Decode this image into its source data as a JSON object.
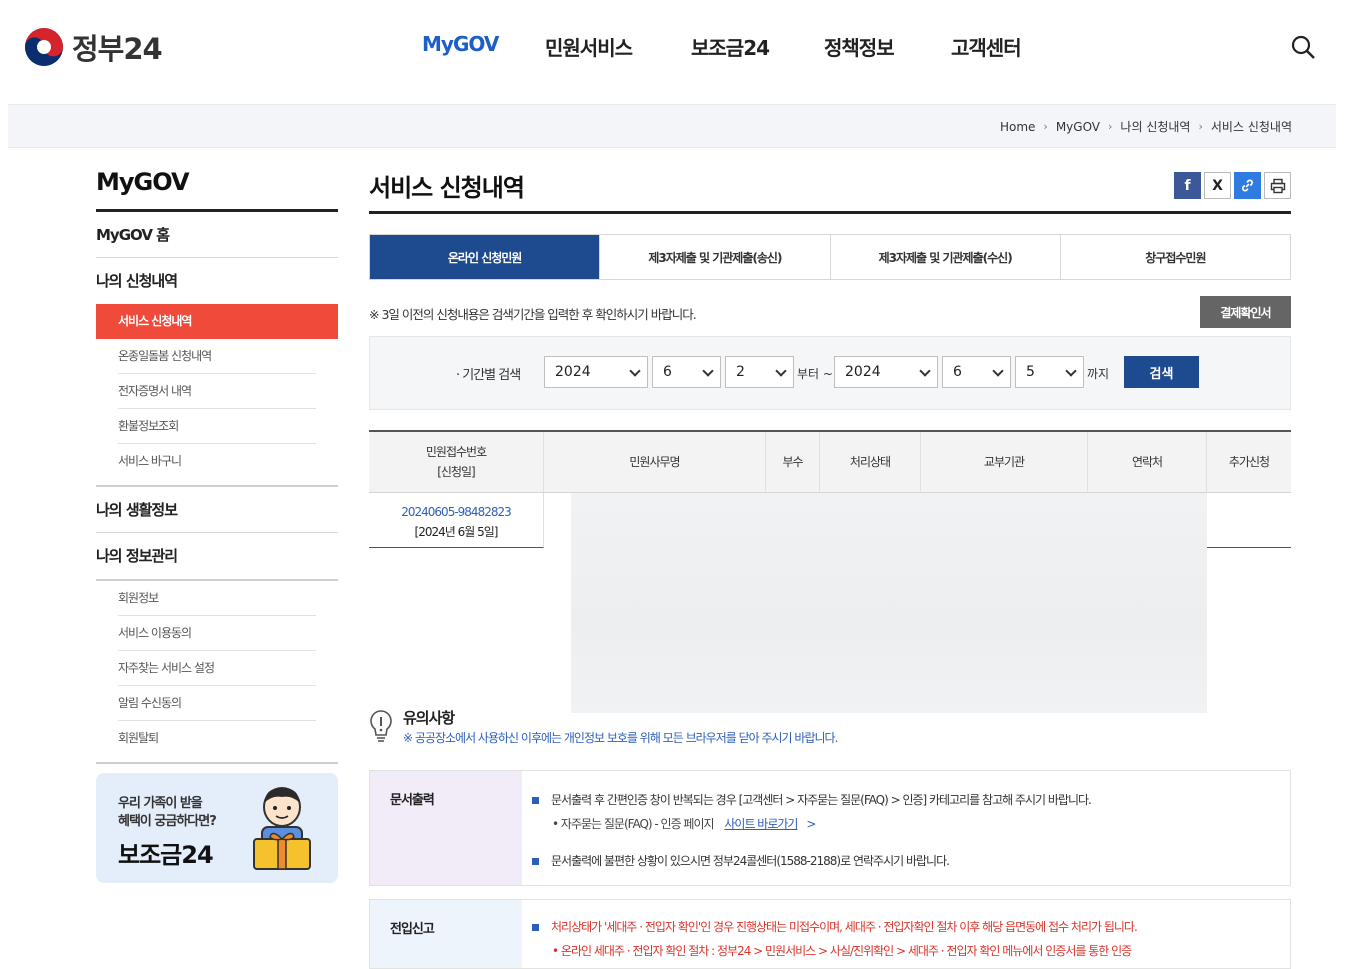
{
  "header": {
    "logo_text": "정부24",
    "nav": [
      "MyGOV",
      "민원서비스",
      "보조금24",
      "정책정보",
      "고객센터"
    ]
  },
  "breadcrumb": [
    "Home",
    "MyGOV",
    "나의 신청내역",
    "서비스 신청내역"
  ],
  "sidebar": {
    "title": "MyGOV",
    "home": "MyGOV 홈",
    "group1": "나의 신청내역",
    "group1_items": [
      "서비스 신청내역",
      "온종일돌봄 신청내역",
      "전자증명서 내역",
      "환불정보조회",
      "서비스 바구니"
    ],
    "group2": "나의 생활정보",
    "group3": "나의 정보관리",
    "group3_items": [
      "회원정보",
      "서비스 이용동의",
      "자주찾는 서비스 설정",
      "알림 수신동의",
      "회원탈퇴"
    ],
    "promo_line1": "우리 가족이 받을",
    "promo_line2": "혜택이 궁금하다면?",
    "promo_title": "보조금24"
  },
  "main": {
    "title": "서비스 신청내역",
    "tabs": [
      "온라인 신청민원",
      "제3자제출 및 기관제출(송신)",
      "제3자제출 및 기관제출(수신)",
      "창구접수민원"
    ],
    "notice": "※ 3일 이전의 신청내용은 검색기간을 입력한 후 확인하시기 바랍니다.",
    "receipt_button": "결제확인서",
    "search": {
      "label": "· 기간별 검색",
      "from_year": "2024",
      "from_month": "6",
      "from_day": "2",
      "from_text": "부터 ~",
      "to_year": "2024",
      "to_month": "6",
      "to_day": "5",
      "to_text": "까지",
      "button": "검색"
    },
    "table": {
      "headers": [
        "민원접수번호",
        "[신청일]",
        "민원사무명",
        "부수",
        "처리상태",
        "교부기관",
        "연락처",
        "추가신청"
      ],
      "rows": [
        {
          "no": "20240605-98482823",
          "date": "[2024년 6월 5일]"
        }
      ]
    },
    "caution": {
      "heading": "유의사항",
      "text": "※ 공공장소에서 사용하신 이후에는 개인정보 보호를 위해 모든 브라우저를 닫아 주시기 바랍니다."
    },
    "info": [
      {
        "label": "문서출력",
        "line1": "문서출력 후 간편인증 창이 반복되는 경우 [고객센터 > 자주묻는 질문(FAQ) > 인증] 카테고리를 참고해 주시기 바랍니다.",
        "sub1": "자주묻는 질문(FAQ) - 인증 페이지",
        "sub1_link": "사이트 바로가기",
        "sub1_arrow": ">",
        "line2": "문서출력에 불편한 상황이 있으시면 정부24콜센터(1588-2188)로 연락주시기 바랍니다."
      },
      {
        "label": "전입신고",
        "line1": "처리상태가 '세대주 · 전입자 확인'인 경우 진행상태는 미접수이며, 세대주 · 전입자확인 절차 이후 해당 읍면동에 접수 처리가 됩니다.",
        "sub1": "온라인 세대주 · 전입자 확인 절차 : 정부24 > 민원서비스 > 사실/진위확인 > 세대주 · 전입자 확인 메뉴에서 인증서를 통한 인증"
      }
    ]
  }
}
